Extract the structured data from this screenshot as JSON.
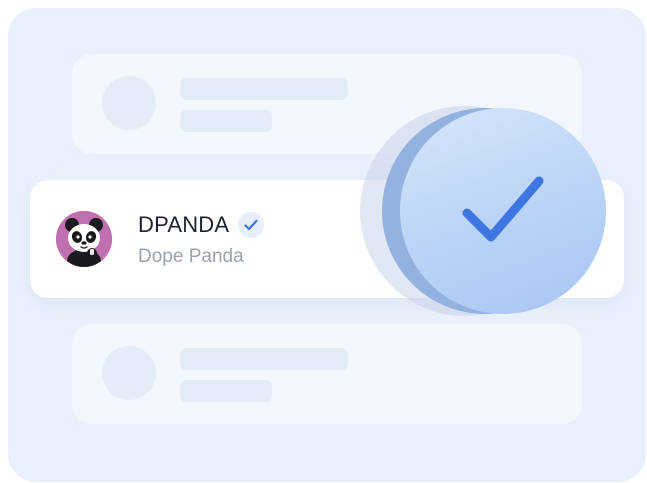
{
  "profile": {
    "username": "DPANDA",
    "display_name": "Dope Panda",
    "verified": true,
    "avatar_icon": "panda-avatar"
  },
  "placeholders": {
    "card_count": 2
  },
  "icons": {
    "verified": "check-icon",
    "confirmation": "big-check-icon"
  },
  "colors": {
    "background": "#eaf0fb",
    "card": "#ffffff",
    "ghost_card": "#f2f6fd",
    "accent_blue": "#3d76e0",
    "avatar_bg": "#c06fb0",
    "text_primary": "#1d2230",
    "text_secondary": "#9aa1ae"
  }
}
